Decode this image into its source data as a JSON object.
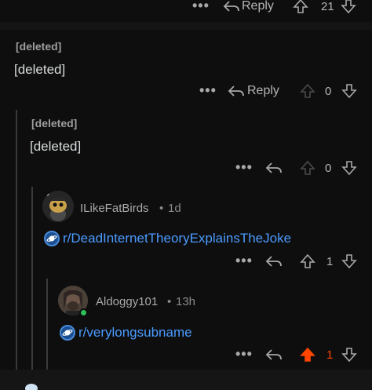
{
  "top_actions": {
    "more_label": "•••",
    "reply_label": "Reply",
    "vote_count": "21"
  },
  "comments": [
    {
      "author": "[deleted]",
      "body": "[deleted]",
      "more_label": "•••",
      "reply_label": "Reply",
      "vote_count": "0"
    },
    {
      "author": "[deleted]",
      "body": "[deleted]",
      "more_label": "•••",
      "vote_count": "0"
    },
    {
      "author": "ILikeFatBirds",
      "separator": "•",
      "time": "1d",
      "subreddit_link": "r/DeadInternetTheoryExplainsTheJoke",
      "more_label": "•••",
      "vote_count": "1"
    },
    {
      "author": "Aldoggy101",
      "separator": "•",
      "time": "13h",
      "subreddit_link": "r/verylongsubname",
      "more_label": "•••",
      "vote_count": "1",
      "upvoted": true
    }
  ],
  "colors": {
    "background": "#0e0e0e",
    "link": "#4a9bff",
    "upvote_active": "#ff4500",
    "online": "#2fbf5b"
  }
}
